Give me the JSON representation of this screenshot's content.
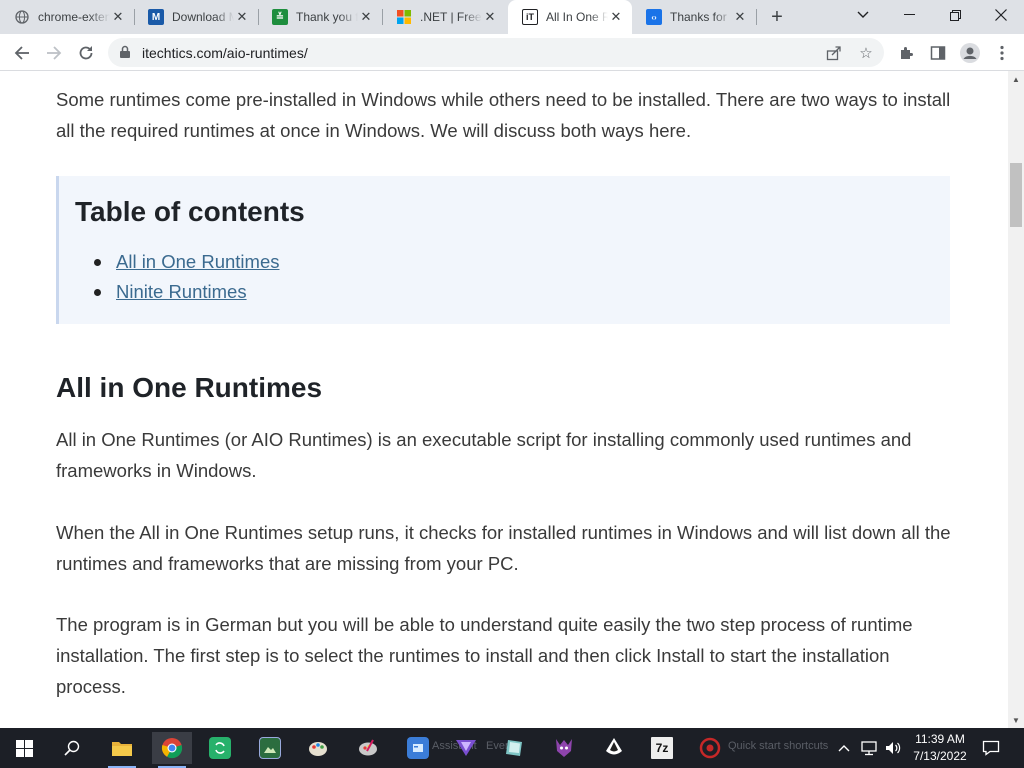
{
  "tabs": [
    {
      "title": "chrome-extension",
      "favicon": "chrome-icon"
    },
    {
      "title": "Download Microsoft",
      "favicon": "microsoft-docs-icon"
    },
    {
      "title": "Thank you for",
      "favicon": "download-green-icon"
    },
    {
      "title": ".NET | Free",
      "favicon": "microsoft-logo-icon"
    },
    {
      "title": "All In One Runtimes",
      "favicon": "itechtics-icon",
      "active": true
    },
    {
      "title": "Thanks for",
      "favicon": "dotnet-blue-icon"
    }
  ],
  "favicon_labels": {
    "microsoft-docs-icon": "M",
    "download-green-icon": "≚",
    "itechtics-icon": "iT",
    "dotnet-blue-icon": "‹›"
  },
  "address_bar": {
    "url": "itechtics.com/aio-runtimes/"
  },
  "article": {
    "intro": "Some runtimes come pre-installed in Windows while others need to be installed. There are two ways to install all the required runtimes at once in Windows. We will discuss both ways here.",
    "toc": {
      "heading": "Table of contents",
      "items": [
        "All in One Runtimes",
        "Ninite Runtimes"
      ]
    },
    "section_heading": "All in One Runtimes",
    "paragraphs": [
      "All in One Runtimes (or AIO Runtimes) is an executable script for installing commonly used runtimes and frameworks in Windows.",
      "When the All in One Runtimes setup runs, it checks for installed runtimes in Windows and will list down all the runtimes and frameworks that are missing from your PC.",
      "The program is in German but you will be able to understand quite easily the two step process of runtime installation. The first step is to select the runtimes to install and then click Install to start the installation process."
    ]
  },
  "taskbar": {
    "apps": [
      "file-explorer",
      "chrome",
      "sync-app",
      "screenshot-tool",
      "paint-app",
      "paint-palette-app",
      "control-panel",
      "affinity-app",
      "notepad-app",
      "devil-app",
      "inkscape-app",
      "7zip",
      "crimson-app"
    ],
    "faded_labels": [
      "Assistant",
      "Events",
      "Quick start shortcuts"
    ],
    "sevenzip_label": "7z",
    "clock_time": "11:39 AM",
    "clock_date": "7/13/2022"
  },
  "colors": {
    "link": "#3b6a8f",
    "toc_background": "#f2f6fc",
    "taskbar": "#1c1f26"
  }
}
